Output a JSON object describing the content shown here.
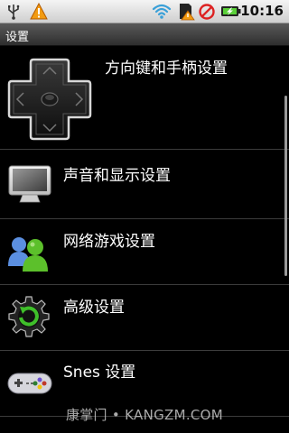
{
  "status_bar": {
    "time": "10:16",
    "icons": [
      "usb-icon",
      "warning-icon",
      "wifi-icon",
      "sd-card-warning-icon",
      "no-sim-icon",
      "battery-charging-icon"
    ]
  },
  "title_bar": {
    "title": "设置"
  },
  "menu": {
    "items": [
      {
        "label": "方向键和手柄设置",
        "icon": "dpad-icon"
      },
      {
        "label": "声音和显示设置",
        "icon": "monitor-icon"
      },
      {
        "label": "网络游戏设置",
        "icon": "buddies-icon"
      },
      {
        "label": "高级设置",
        "icon": "gear-refresh-icon"
      },
      {
        "label": "Snes 设置",
        "icon": "snes-controller-icon"
      }
    ]
  },
  "watermark": {
    "text": "康掌门 • KANGZM.COM"
  }
}
